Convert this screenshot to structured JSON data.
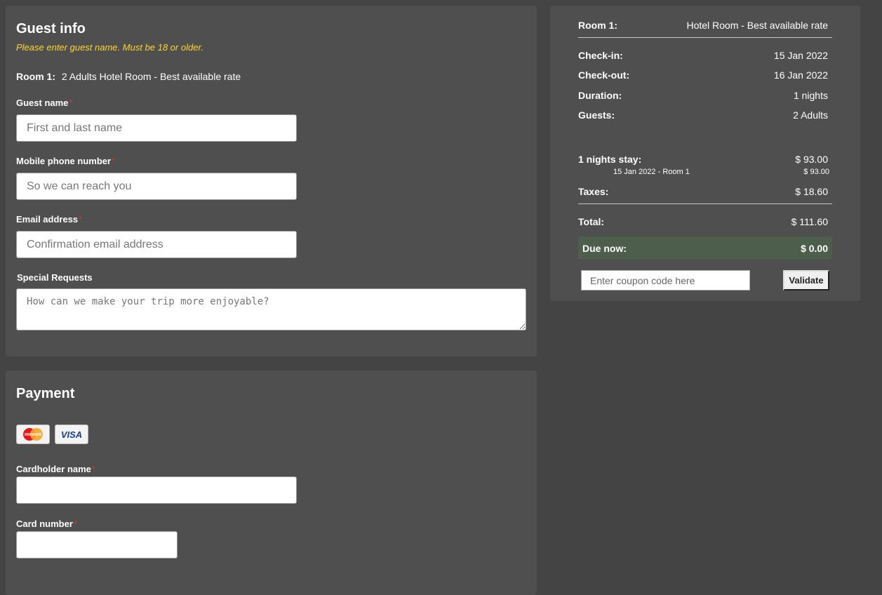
{
  "guest": {
    "title": "Guest info",
    "hint": "Please enter guest name. Must be 18 or older.",
    "room_label": "Room 1:",
    "room_value": "2 Adults Hotel Room - Best available rate",
    "name_label": "Guest name",
    "name_placeholder": "First and last name",
    "phone_label": "Mobile phone number",
    "phone_placeholder": "So we can reach you",
    "email_label": "Email address",
    "email_placeholder": "Confirmation email address",
    "requests_label": "Special Requests",
    "requests_placeholder": "How can we make your trip more enjoyable?",
    "required_mark": "*"
  },
  "payment": {
    "title": "Payment",
    "cards": [
      "mastercard-icon",
      "visa-icon"
    ],
    "visa_text": "VISA",
    "cardholder_label": "Cardholder name",
    "card_number_label": "Card number",
    "required_mark": "*"
  },
  "summary": {
    "room_label": "Room 1:",
    "room_value": "Hotel Room - Best available rate",
    "checkin_label": "Check-in:",
    "checkin_value": "15 Jan 2022",
    "checkout_label": "Check-out:",
    "checkout_value": "16 Jan 2022",
    "duration_label": "Duration:",
    "duration_value": "1 nights",
    "guests_label": "Guests:",
    "guests_value": "2 Adults",
    "stay_label": "1 nights stay:",
    "stay_value": "$ 93.00",
    "stay_detail_label": "15 Jan 2022 - Room 1",
    "stay_detail_value": "$ 93.00",
    "taxes_label": "Taxes:",
    "taxes_value": "$ 18.60",
    "total_label": "Total:",
    "total_value": "$ 111.60",
    "due_label": "Due now:",
    "due_value": "$ 0.00",
    "coupon_placeholder": "Enter coupon code here",
    "validate_label": "Validate"
  },
  "colors": {
    "background": "#444444",
    "panel": "#4f4f4f",
    "hint": "#ffd633",
    "required": "#e03030",
    "due_bg": "#4d5e4c"
  }
}
